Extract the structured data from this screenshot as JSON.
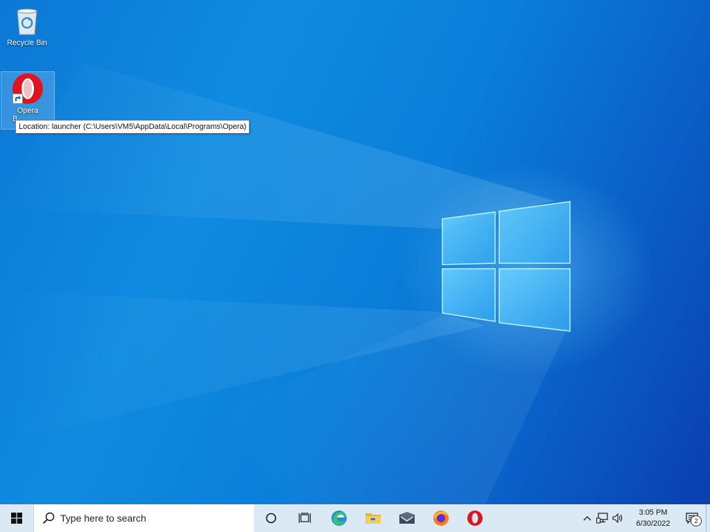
{
  "desktop": {
    "icons": [
      {
        "label": "Recycle Bin"
      },
      {
        "label": "Opera",
        "label_line2": "B"
      }
    ],
    "tooltip": "Location: launcher (C:\\Users\\VM5\\AppData\\Local\\Programs\\Opera)"
  },
  "taskbar": {
    "search_placeholder": "Type here to search",
    "pinned": [
      "cortana-icon",
      "task-view-icon",
      "edge-icon",
      "file-explorer-icon",
      "mail-icon",
      "firefox-icon",
      "opera-icon"
    ],
    "clock": {
      "time": "3:05 PM",
      "date": "6/30/2022"
    },
    "notification_count": "2"
  },
  "colors": {
    "taskbar_bg": "#dbe9f4",
    "opera_red": "#e0141e",
    "wallpaper_blue": "#0b78d6"
  }
}
